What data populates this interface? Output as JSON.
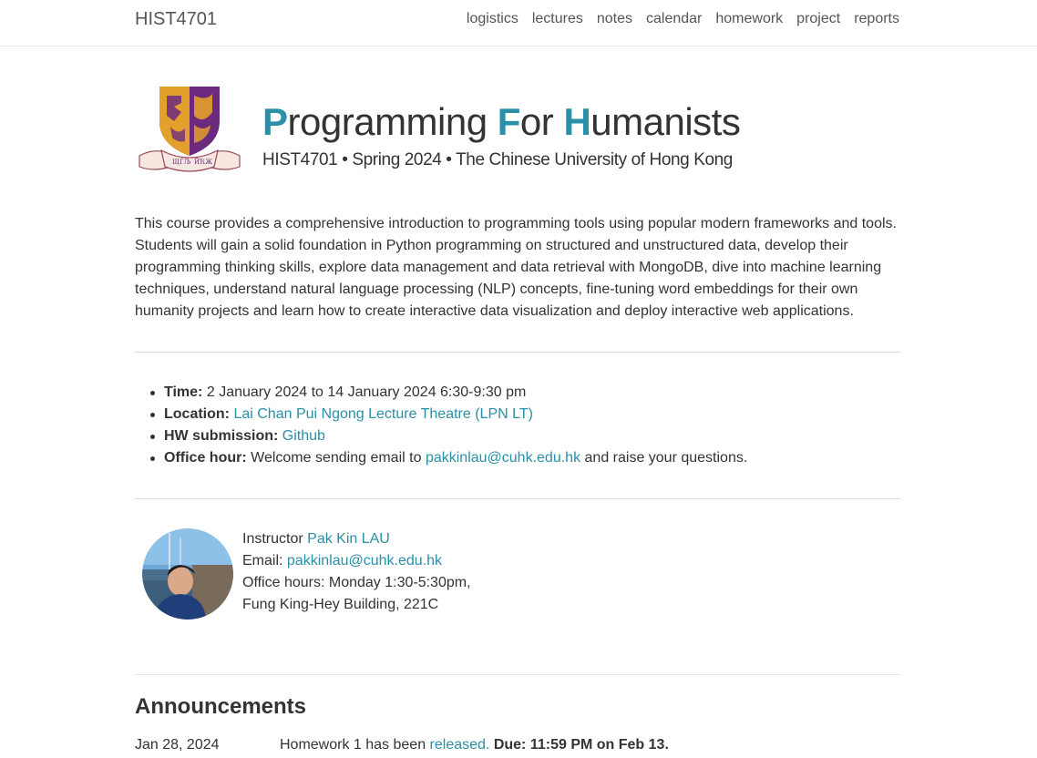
{
  "nav": {
    "brand": "HIST4701",
    "links": [
      "logistics",
      "lectures",
      "notes",
      "calendar",
      "homework",
      "project",
      "reports"
    ]
  },
  "header": {
    "title_parts": [
      {
        "cap": "P",
        "rest": "rogramming "
      },
      {
        "cap": "F",
        "rest": "or "
      },
      {
        "cap": "H",
        "rest": "umanists"
      }
    ],
    "subtitle": "HIST4701 • Spring 2024 • The Chinese University of Hong Kong",
    "logo_icon": "cuhk-crest-icon"
  },
  "description": "This course provides a comprehensive introduction to programming tools using popular modern frameworks and tools. Students will gain a solid foundation in Python programming on structured and unstructured data, develop their programming thinking skills, explore data management and data retrieval with MongoDB, dive into machine learning techniques, understand natural language processing (NLP) concepts, fine-tuning word embeddings for their own humanity projects and learn how to create interactive data visualization and deploy interactive web applications.",
  "logistics": {
    "time_label": "Time:",
    "time_value": "2 January 2024 to 14 January 2024 6:30-9:30 pm",
    "location_label": "Location:",
    "location_link": "Lai Chan Pui Ngong Lecture Theatre (LPN LT)",
    "hw_label": "HW submission:",
    "hw_link": "Github",
    "office_label": "Office hour:",
    "office_pre": "Welcome sending email to",
    "office_email": "pakkinlau@cuhk.edu.hk",
    "office_post": "and raise your questions."
  },
  "instructor": {
    "role": "Instructor",
    "name": "Pak Kin LAU",
    "email_label": "Email:",
    "email": "pakkinlau@cuhk.edu.hk",
    "hours": "Office hours: Monday 1:30-5:30pm,",
    "location": "Fung King-Hey Building, 221C"
  },
  "announcements": {
    "title": "Announcements",
    "items": [
      {
        "date": "Jan 28, 2024",
        "text": "Homework 1 has been",
        "link": "released.",
        "due": "Due: 11:59 PM on Feb 13."
      }
    ]
  },
  "colors": {
    "accent": "#2a8fa7",
    "crest_purple": "#6b2a7e",
    "crest_gold": "#e3a02c"
  }
}
